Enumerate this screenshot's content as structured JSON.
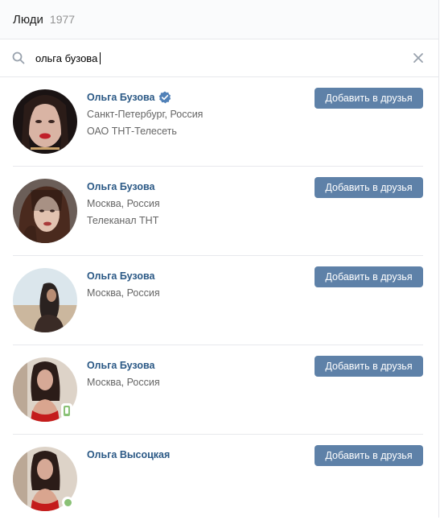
{
  "header": {
    "title": "Люди",
    "count": "1977"
  },
  "search": {
    "value": "ольга бузова",
    "icon": "search-icon",
    "clear_icon": "close-icon"
  },
  "colors": {
    "link": "#2a5885",
    "button": "#5e81a8",
    "online": "#8ac176",
    "verified": "#5181b8"
  },
  "results": [
    {
      "name": "Ольга Бузова",
      "verified": true,
      "line1": "Санкт-Петербург, Россия",
      "line2": "ОАО ТНТ-Телесеть",
      "button": "Добавить в друзья",
      "online": "none"
    },
    {
      "name": "Ольга Бузова",
      "verified": false,
      "line1": "Москва, Россия",
      "line2": "Телеканал ТНТ",
      "button": "Добавить в друзья",
      "online": "none"
    },
    {
      "name": "Ольга Бузова",
      "verified": false,
      "line1": "Москва, Россия",
      "line2": "",
      "button": "Добавить в друзья",
      "online": "none"
    },
    {
      "name": "Ольга Бузова",
      "verified": false,
      "line1": "Москва, Россия",
      "line2": "",
      "button": "Добавить в друзья",
      "online": "mobile"
    },
    {
      "name": "Ольга Высоцкая",
      "verified": false,
      "line1": "",
      "line2": "",
      "button": "Добавить в друзья",
      "online": "web"
    }
  ]
}
